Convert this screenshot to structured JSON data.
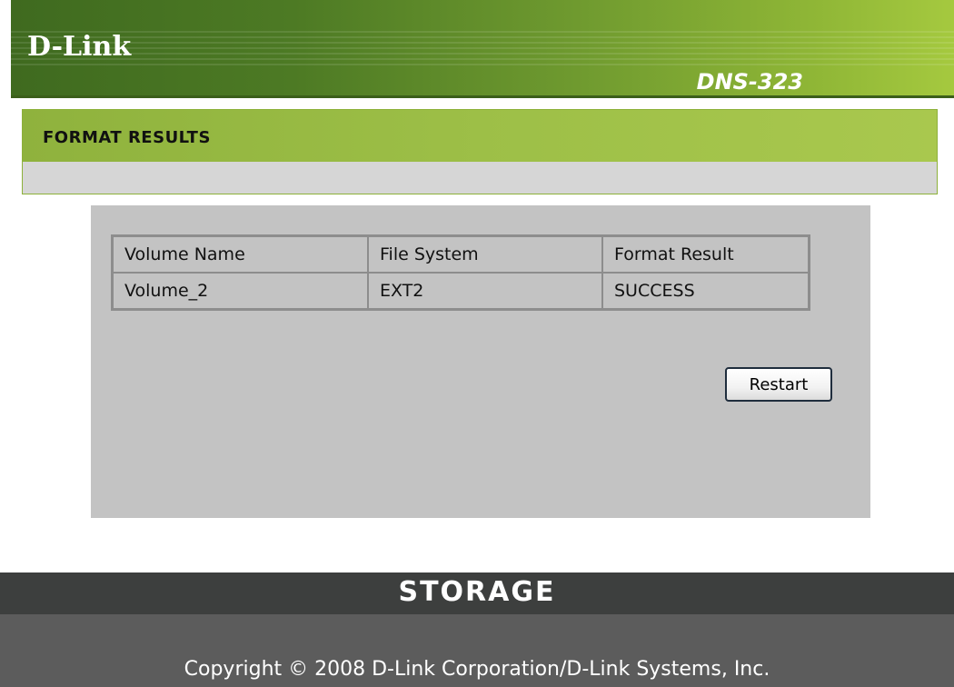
{
  "header": {
    "logo": "D-Link",
    "model": "DNS-323"
  },
  "section": {
    "title": "FORMAT RESULTS"
  },
  "results_table": {
    "headers": [
      "Volume Name",
      "File System",
      "Format Result"
    ],
    "rows": [
      [
        "Volume_2",
        "EXT2",
        "SUCCESS"
      ]
    ]
  },
  "actions": {
    "restart_label": "Restart"
  },
  "footer": {
    "brand": "STORAGE",
    "copyright": "Copyright © 2008 D-Link Corporation/D-Link Systems, Inc."
  },
  "colors": {
    "header_green": "#4d7a24",
    "section_green": "#9dbf47",
    "panel_gray": "#c3c3c3",
    "footer_dark": "#3d3f3e",
    "footer_gray": "#5c5c5c"
  }
}
